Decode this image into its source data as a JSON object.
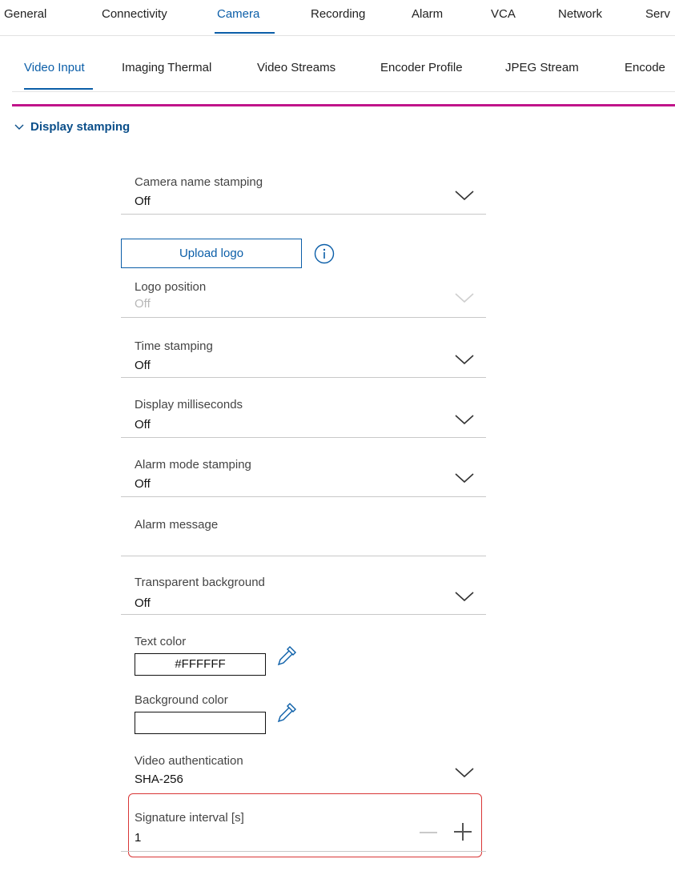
{
  "top_tabs": [
    "General",
    "Connectivity",
    "Camera",
    "Recording",
    "Alarm",
    "VCA",
    "Network",
    "Serv"
  ],
  "top_tabs_active": "Camera",
  "sub_tabs": [
    "Video Input",
    "Imaging Thermal",
    "Video Streams",
    "Encoder Profile",
    "JPEG Stream",
    "Encode"
  ],
  "sub_tabs_active": "Video Input",
  "section": {
    "title": "Display stamping",
    "expanded": true
  },
  "fields": {
    "camera_name": {
      "label": "Camera name stamping",
      "value": "Off"
    },
    "upload_logo": "Upload logo",
    "logo_position": {
      "label": "Logo position",
      "value": "Off",
      "disabled": true
    },
    "time_stamping": {
      "label": "Time stamping",
      "value": "Off"
    },
    "display_ms": {
      "label": "Display milliseconds",
      "value": "Off"
    },
    "alarm_mode": {
      "label": "Alarm mode stamping",
      "value": "Off"
    },
    "alarm_message": {
      "label": "Alarm message",
      "value": ""
    },
    "transparent_bg": {
      "label": "Transparent background",
      "value": "Off"
    },
    "text_color": {
      "label": "Text color",
      "value": "#FFFFFF"
    },
    "background_color": {
      "label": "Background color",
      "value": ""
    },
    "video_auth": {
      "label": "Video authentication",
      "value": "SHA-256"
    },
    "signature_interval": {
      "label": "Signature interval [s]",
      "value": "1"
    }
  },
  "colors": {
    "accent": "#0b5ea8",
    "magenta_bar": "#c0148a",
    "highlight": "#d93636"
  },
  "icons": {
    "info": "info-icon",
    "pipette": "eyedropper-icon",
    "chevron": "chevron-down-icon"
  }
}
